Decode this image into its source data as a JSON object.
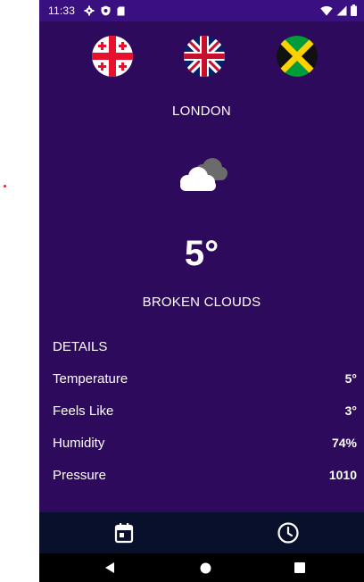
{
  "status_bar": {
    "time": "11:33",
    "left_icons": [
      "settings-icon",
      "shield-icon",
      "sd-card-icon"
    ],
    "right_icons": [
      "wifi-icon",
      "signal-icon",
      "battery-icon"
    ]
  },
  "flags": [
    {
      "name": "georgia-flag",
      "country": "Georgia"
    },
    {
      "name": "uk-flag",
      "country": "United Kingdom"
    },
    {
      "name": "jamaica-flag",
      "country": "Jamaica"
    }
  ],
  "weather": {
    "city": "LONDON",
    "icon": "broken-clouds-icon",
    "temperature": "5°",
    "condition": "BROKEN CLOUDS"
  },
  "details": {
    "title": "DETAILS",
    "rows": [
      {
        "label": "Temperature",
        "value": "5°"
      },
      {
        "label": "Feels Like",
        "value": "3°"
      },
      {
        "label": "Humidity",
        "value": "74%"
      },
      {
        "label": "Pressure",
        "value": "1010"
      }
    ]
  },
  "bottom_nav": {
    "items": [
      "calendar-icon",
      "clock-icon"
    ]
  },
  "system_nav": [
    "back-icon",
    "home-icon",
    "recents-icon"
  ],
  "colors": {
    "background": "#2d0a5c",
    "status_bar": "#3a0f80",
    "bottom_nav": "#09102b",
    "text": "#ffffff"
  }
}
